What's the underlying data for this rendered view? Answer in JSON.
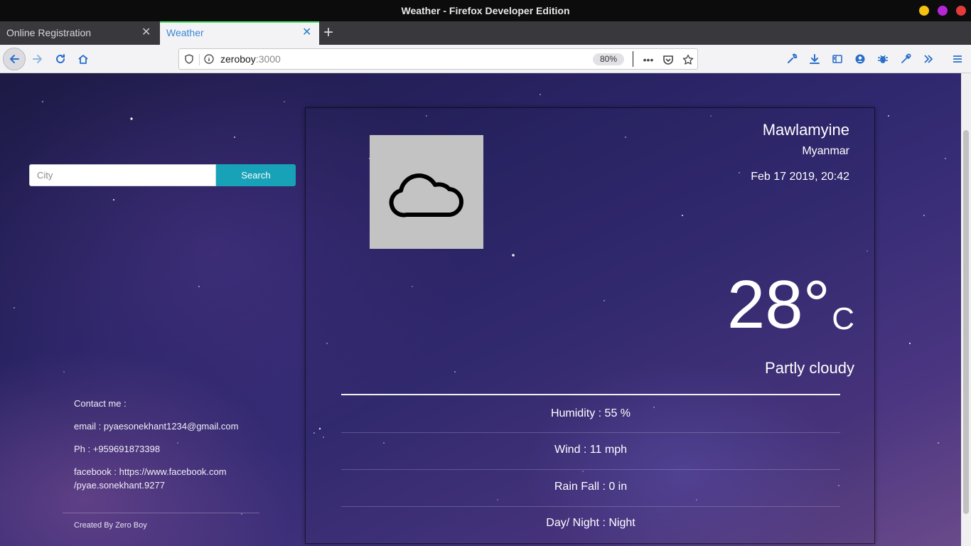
{
  "window": {
    "title": "Weather - Firefox Developer Edition",
    "controls": {
      "minimize_color": "#f5c211",
      "maximize_color": "#b527d6",
      "close_color": "#e33a3a"
    }
  },
  "tabs": [
    {
      "label": "Online Registration",
      "active": false
    },
    {
      "label": "Weather",
      "active": true
    }
  ],
  "navbar": {
    "url_host": "zeroboy",
    "url_port": ":3000",
    "zoom": "80%"
  },
  "search": {
    "placeholder": "City",
    "button_label": "Search",
    "button_color": "#17a2b8"
  },
  "contact": {
    "heading": "Contact me :",
    "email": "email : pyaesonekhant1234@gmail.com",
    "phone": "Ph : +959691873398",
    "facebook_line1": "facebook : https://www.facebook.com",
    "facebook_line2": "/pyae.sonekhant.9277",
    "credit": "Created By Zero Boy"
  },
  "weather": {
    "city": "Mawlamyine",
    "country": "Myanmar",
    "datetime": "Feb 17 2019, 20:42",
    "temperature": "28°",
    "unit": "C",
    "condition": "Partly cloudy",
    "icon": "cloud-icon",
    "stats": {
      "humidity": "Humidity : 55 %",
      "wind": "Wind : 11 mph",
      "rainfall": "Rain Fall : 0 in",
      "daynight": "Day/ Night : Night"
    }
  }
}
